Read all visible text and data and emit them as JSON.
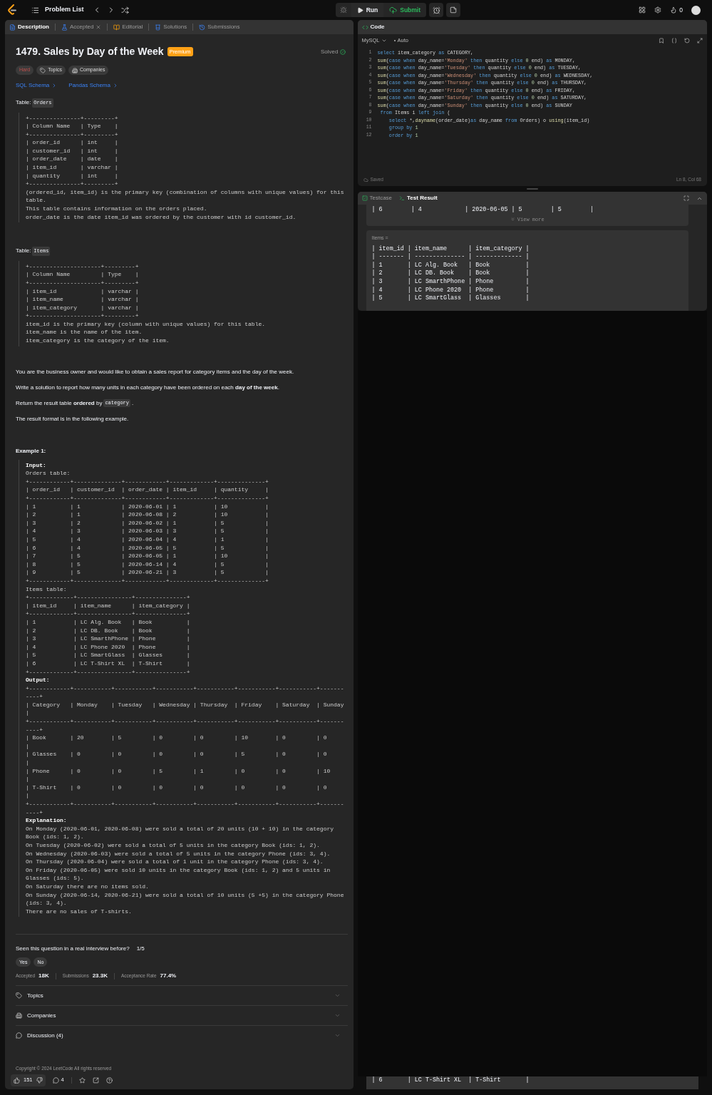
{
  "top_bar": {
    "title": "Problem List",
    "run": "Run",
    "submit": "Submit",
    "streak": "0"
  },
  "left_tabs": [
    {
      "label": "Description",
      "selected": true,
      "closable": false,
      "kind": "description"
    },
    {
      "label": "Accepted",
      "selected": false,
      "closable": true,
      "kind": "accepted"
    },
    {
      "label": "Editorial",
      "selected": false,
      "closable": false,
      "kind": "editorial"
    },
    {
      "label": "Solutions",
      "selected": false,
      "closable": false,
      "kind": "solutions"
    },
    {
      "label": "Submissions",
      "selected": false,
      "closable": false,
      "kind": "submissions"
    }
  ],
  "problem": {
    "title": "1479. Sales by Day of the Week",
    "badge": "Premium",
    "status": "Solved",
    "tags": [
      {
        "kind": "difficulty",
        "label": "Hard"
      },
      {
        "kind": "topics",
        "label": "Topics"
      },
      {
        "kind": "companies",
        "label": "Companies"
      }
    ],
    "links": [
      "SQL Schema",
      "Pandas Schema"
    ],
    "schemas": [
      {
        "label": "Table:",
        "table": "Orders",
        "lines": [
          "+---------------+---------+",
          "| Column Name   | Type    |",
          "+---------------+---------+",
          "| order_id      | int     |",
          "| customer_id   | int     |",
          "| order_date    | date    |",
          "| item_id       | varchar |",
          "| quantity      | int     |",
          "+---------------+---------+",
          "(ordered_id, item_id) is the primary key (combination of columns with unique values) for this table.",
          "This table contains information on the orders placed.",
          "order_date is the date item_id was ordered by the customer with id customer_id."
        ]
      },
      {
        "label": "Table:",
        "table": "Items",
        "lines": [
          "+---------------------+---------+",
          "| Column Name         | Type    |",
          "+---------------------+---------+",
          "| item_id             | varchar |",
          "| item_name           | varchar |",
          "| item_category       | varchar |",
          "+---------------------+---------+",
          "item_id is the primary key (column with unique values) for this table.",
          "item_name is the name of the item.",
          "item_category is the category of the item."
        ]
      }
    ],
    "paragraphs": [
      [
        {
          "kind": "text",
          "text": "You are the business owner and would like to obtain a sales report for category items and the day of the week."
        }
      ],
      [
        {
          "kind": "text",
          "text": "Write a solution to report how many units in each category have been ordered on each **day of the week**."
        }
      ],
      [
        {
          "kind": "text",
          "text": "Return the result table **ordered** by"
        },
        {
          "kind": "code",
          "text": "category"
        },
        {
          "kind": "text",
          "text": "."
        }
      ],
      [
        {
          "kind": "text",
          "text": "The result format is in the following example."
        }
      ]
    ],
    "example": {
      "title": "Example 1:",
      "sections": [
        {
          "heading": "Input:",
          "lines": [
            "Orders table:",
            "+------------+--------------+------------+-------------+--------------+",
            "| order_id   | customer_id  | order_date | item_id     | quantity     |",
            "+------------+--------------+------------+-------------+--------------+",
            "| 1          | 1            | 2020-06-01 | 1           | 10           |",
            "| 2          | 1            | 2020-06-08 | 2           | 10           |",
            "| 3          | 2            | 2020-06-02 | 1           | 5            |",
            "| 4          | 3            | 2020-06-03 | 3           | 5            |",
            "| 5          | 4            | 2020-06-04 | 4           | 1            |",
            "| 6          | 4            | 2020-06-05 | 5           | 5            |",
            "| 7          | 5            | 2020-06-05 | 1           | 10           |",
            "| 8          | 5            | 2020-06-14 | 4           | 5            |",
            "| 9          | 5            | 2020-06-21 | 3           | 5            |",
            "+------------+--------------+------------+-------------+--------------+",
            "Items table:",
            "+-------------+----------------+---------------+",
            "| item_id     | item_name      | item_category |",
            "+-------------+----------------+---------------+",
            "| 1           | LC Alg. Book   | Book          |",
            "| 2           | LC DB. Book    | Book          |",
            "| 3           | LC SmarthPhone | Phone         |",
            "| 4           | LC Phone 2020  | Phone         |",
            "| 5           | LC SmartGlass  | Glasses       |",
            "| 6           | LC T-Shirt XL  | T-Shirt       |",
            "+-------------+----------------+---------------+"
          ]
        },
        {
          "heading": "Output:",
          "lines": [
            "+------------+-----------+-----------+-----------+-----------+-----------+-----------+-------",
            "----+",
            "| Category   | Monday    | Tuesday   | Wednesday | Thursday  | Friday    | Saturday  | Sunday",
            "|",
            "+------------+-----------+-----------+-----------+-----------+-----------+-----------+-------",
            "----+",
            "| Book       | 20        | 5         | 0         | 0         | 10        | 0         | 0",
            "|",
            "| Glasses    | 0         | 0         | 0         | 0         | 5         | 0         | 0",
            "|",
            "| Phone      | 0         | 0         | 5         | 1         | 0         | 0         | 10",
            "|",
            "| T-Shirt    | 0         | 0         | 0         | 0         | 0         | 0         | 0",
            "|",
            "+------------+-----------+-----------+-----------+-----------+-----------+-----------+-------",
            "----+"
          ]
        },
        {
          "heading": "Explanation:",
          "lines": [
            "On Monday (2020-06-01, 2020-06-08) were sold a total of 20 units (10 + 10) in the category Book (ids: 1, 2).",
            "On Tuesday (2020-06-02) were sold a total of 5 units in the category Book (ids: 1, 2).",
            "On Wednesday (2020-06-03) were sold a total of 5 units in the category Phone (ids: 3, 4).",
            "On Thursday (2020-06-04) were sold a total of 1 unit in the category Phone (ids: 3, 4).",
            "On Friday (2020-06-05) were sold 10 units in the category Book (ids: 1, 2) and 5 units in Glasses (ids: 5).",
            "On Saturday there are no items sold.",
            "On Sunday (2020-06-14, 2020-06-21) were sold a total of 10 units (5 +5) in the category Phone (ids: 3, 4).",
            "There are no sales of T-shirts."
          ]
        }
      ]
    }
  },
  "feedback": {
    "question": "Seen this question in a real interview before?",
    "count": "1/5",
    "options": [
      "Yes",
      "No"
    ]
  },
  "stats": [
    {
      "label": "Accepted",
      "value": "18K"
    },
    {
      "label": "Submissions",
      "value": "23.3K"
    },
    {
      "label": "Acceptance Rate",
      "value": "77.4%"
    }
  ],
  "sections": [
    {
      "kind": "topics",
      "label": "Topics",
      "expanded": false
    },
    {
      "kind": "companies",
      "label": "Companies",
      "expanded": false
    },
    {
      "kind": "discussion",
      "label": "Discussion (4)",
      "expanded": false
    }
  ],
  "copyright": "Copyright © 2024 LeetCode All rights reserved",
  "toolbar": {
    "likes": "151",
    "comments": "4"
  },
  "code_panel": {
    "title": "Code",
    "language": "MySQL",
    "mode": "Auto",
    "status": "Saved",
    "cursor": "Ln 8, Col 68",
    "lines": [
      {
        "number": "1",
        "tokens": [
          {
            "kind": "k",
            "text": "select"
          },
          {
            "kind": "p",
            "text": " item_category "
          },
          {
            "kind": "k",
            "text": "as"
          },
          {
            "kind": "p",
            "text": " CATEGORY,"
          }
        ]
      },
      {
        "number": "2",
        "tokens": [
          {
            "kind": "f",
            "text": "sum"
          },
          {
            "kind": "p",
            "text": "("
          },
          {
            "kind": "k",
            "text": "case when"
          },
          {
            "kind": "p",
            "text": " day_name="
          },
          {
            "kind": "s",
            "text": "'Monday'"
          },
          {
            "kind": "k",
            "text": " then"
          },
          {
            "kind": "p",
            "text": " quantity "
          },
          {
            "kind": "k",
            "text": "else"
          },
          {
            "kind": "n",
            "text": " 0"
          },
          {
            "kind": "p",
            "text": " end) "
          },
          {
            "kind": "k",
            "text": "as"
          },
          {
            "kind": "p",
            "text": " MONDAY,"
          }
        ]
      },
      {
        "number": "3",
        "tokens": [
          {
            "kind": "f",
            "text": "sum"
          },
          {
            "kind": "p",
            "text": "("
          },
          {
            "kind": "k",
            "text": "case when"
          },
          {
            "kind": "p",
            "text": " day_name="
          },
          {
            "kind": "s",
            "text": "'Tuesday'"
          },
          {
            "kind": "k",
            "text": " then"
          },
          {
            "kind": "p",
            "text": " quantity "
          },
          {
            "kind": "k",
            "text": "else"
          },
          {
            "kind": "n",
            "text": " 0"
          },
          {
            "kind": "p",
            "text": " end) "
          },
          {
            "kind": "k",
            "text": "as"
          },
          {
            "kind": "p",
            "text": " TUESDAY,"
          }
        ]
      },
      {
        "number": "4",
        "tokens": [
          {
            "kind": "f",
            "text": "sum"
          },
          {
            "kind": "p",
            "text": "("
          },
          {
            "kind": "k",
            "text": "case when"
          },
          {
            "kind": "p",
            "text": " day_name="
          },
          {
            "kind": "s",
            "text": "'Wednesday'"
          },
          {
            "kind": "k",
            "text": " then"
          },
          {
            "kind": "p",
            "text": " quantity "
          },
          {
            "kind": "k",
            "text": "else"
          },
          {
            "kind": "n",
            "text": " 0"
          },
          {
            "kind": "p",
            "text": " end) "
          },
          {
            "kind": "k",
            "text": "as"
          },
          {
            "kind": "p",
            "text": " WEDNESDAY,"
          }
        ]
      },
      {
        "number": "5",
        "tokens": [
          {
            "kind": "f",
            "text": "sum"
          },
          {
            "kind": "p",
            "text": "("
          },
          {
            "kind": "k",
            "text": "case when"
          },
          {
            "kind": "p",
            "text": " day_name="
          },
          {
            "kind": "s",
            "text": "'Thursday'"
          },
          {
            "kind": "k",
            "text": " then"
          },
          {
            "kind": "p",
            "text": " quantity "
          },
          {
            "kind": "k",
            "text": "else"
          },
          {
            "kind": "n",
            "text": " 0"
          },
          {
            "kind": "p",
            "text": " end) "
          },
          {
            "kind": "k",
            "text": "as"
          },
          {
            "kind": "p",
            "text": " THURSDAY,"
          }
        ]
      },
      {
        "number": "6",
        "tokens": [
          {
            "kind": "f",
            "text": "sum"
          },
          {
            "kind": "p",
            "text": "("
          },
          {
            "kind": "k",
            "text": "case when"
          },
          {
            "kind": "p",
            "text": " day_name="
          },
          {
            "kind": "s",
            "text": "'Friday'"
          },
          {
            "kind": "k",
            "text": " then"
          },
          {
            "kind": "p",
            "text": " quantity "
          },
          {
            "kind": "k",
            "text": "else"
          },
          {
            "kind": "n",
            "text": " 0"
          },
          {
            "kind": "p",
            "text": " end) "
          },
          {
            "kind": "k",
            "text": "as"
          },
          {
            "kind": "p",
            "text": " FRIDAY,"
          }
        ]
      },
      {
        "number": "7",
        "tokens": [
          {
            "kind": "f",
            "text": "sum"
          },
          {
            "kind": "p",
            "text": "("
          },
          {
            "kind": "k",
            "text": "case when"
          },
          {
            "kind": "p",
            "text": " day_name="
          },
          {
            "kind": "s",
            "text": "'Saturday'"
          },
          {
            "kind": "k",
            "text": " then"
          },
          {
            "kind": "p",
            "text": " quantity "
          },
          {
            "kind": "k",
            "text": "else"
          },
          {
            "kind": "n",
            "text": " 0"
          },
          {
            "kind": "p",
            "text": " end) "
          },
          {
            "kind": "k",
            "text": "as"
          },
          {
            "kind": "p",
            "text": " SATURDAY,"
          }
        ]
      },
      {
        "number": "8",
        "tokens": [
          {
            "kind": "f",
            "text": "sum"
          },
          {
            "kind": "p",
            "text": "("
          },
          {
            "kind": "k",
            "text": "case when"
          },
          {
            "kind": "p",
            "text": " day_name="
          },
          {
            "kind": "s",
            "text": "'Sunday'"
          },
          {
            "kind": "k",
            "text": " then"
          },
          {
            "kind": "p",
            "text": " quantity "
          },
          {
            "kind": "k",
            "text": "else"
          },
          {
            "kind": "n",
            "text": " 0"
          },
          {
            "kind": "p",
            "text": " end) "
          },
          {
            "kind": "k",
            "text": "as"
          },
          {
            "kind": "p",
            "text": " SUNDAY"
          }
        ]
      },
      {
        "number": "9",
        "tokens": [
          {
            "kind": "k",
            "text": " from"
          },
          {
            "kind": "p",
            "text": " Items i "
          },
          {
            "kind": "k",
            "text": "left join"
          },
          {
            "kind": "p",
            "text": " ("
          }
        ]
      },
      {
        "number": "10",
        "tokens": [
          {
            "kind": "k",
            "text": "    select"
          },
          {
            "kind": "p",
            "text": " *,"
          },
          {
            "kind": "f",
            "text": "dayname"
          },
          {
            "kind": "p",
            "text": "(order_date)"
          },
          {
            "kind": "k",
            "text": "as"
          },
          {
            "kind": "p",
            "text": " day_name "
          },
          {
            "kind": "k",
            "text": "from"
          },
          {
            "kind": "p",
            "text": " Orders) o "
          },
          {
            "kind": "f",
            "text": "using"
          },
          {
            "kind": "p",
            "text": "(item_id)"
          }
        ]
      },
      {
        "number": "11",
        "tokens": [
          {
            "kind": "k",
            "text": "    group by"
          },
          {
            "kind": "n",
            "text": " 1"
          }
        ]
      },
      {
        "number": "12",
        "tokens": [
          {
            "kind": "k",
            "text": "    order by"
          },
          {
            "kind": "n",
            "text": " 1"
          }
        ]
      }
    ]
  },
  "result_panel": {
    "tabs": [
      {
        "kind": "testcase",
        "label": "Testcase",
        "selected": false
      },
      {
        "kind": "result",
        "label": "Test Result",
        "selected": true
      }
    ],
    "orders_tail": "| 6        | 4            | 2020-06-05 | 5        | 5        |",
    "view_more": "View more",
    "items_label": "Items =",
    "items_lines": [
      "| item_id | item_name      | item_category |",
      "| ------- | -------------- | ------------- |",
      "| 1       | LC Alg. Book   | Book          |",
      "| 2       | LC DB. Book    | Book          |",
      "| 3       | LC SmarthPhone | Phone         |",
      "| 4       | LC Phone 2020  | Phone         |",
      "| 5       | LC SmartGlass  | Glasses       |"
    ],
    "bottom_line": "| 6       | LC T-Shirt XL  | T-Shirt       |"
  }
}
